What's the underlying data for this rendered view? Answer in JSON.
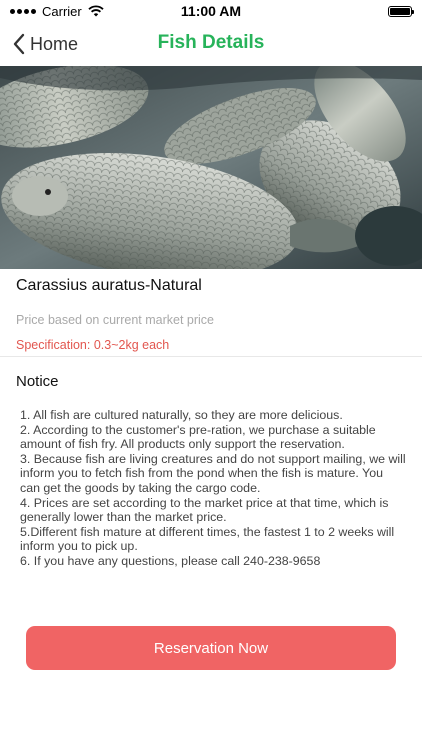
{
  "status_bar": {
    "carrier": "Carrier",
    "time": "11:00 AM",
    "icons": [
      "signal-dots-icon",
      "wifi-icon",
      "battery-icon"
    ]
  },
  "nav": {
    "back_label": "Home",
    "back_icon": "chevron-left-icon",
    "title": "Fish Details",
    "title_color": "#27b35a"
  },
  "hero_image": {
    "subject": "crucian carp fish in a net"
  },
  "product": {
    "name": "Carassius auratus-Natural",
    "price_note": "Price based on current market price",
    "specification": "Specification: 0.3~2kg each",
    "spec_color": "#e2564f"
  },
  "notice": {
    "title": "Notice",
    "items": [
      "1. All fish are cultured naturally, so they are more delicious.",
      "2. According to the customer's pre-ration, we purchase a suitable amount of fish fry. All products only support the reservation.",
      "3. Because fish are living creatures and do not support mailing, we will inform you to fetch fish from the pond when the fish is mature. You can get the goods by taking the cargo code.",
      "4. Prices are set according to the market price at that time, which is generally lower than the market price.",
      "5.Different fish mature at different times, the fastest 1 to 2 weeks will inform you to pick up.",
      "6. If you have any questions, please call 240-238-9658"
    ]
  },
  "actions": {
    "reserve_label": "Reservation Now",
    "reserve_color": "#f06464"
  }
}
